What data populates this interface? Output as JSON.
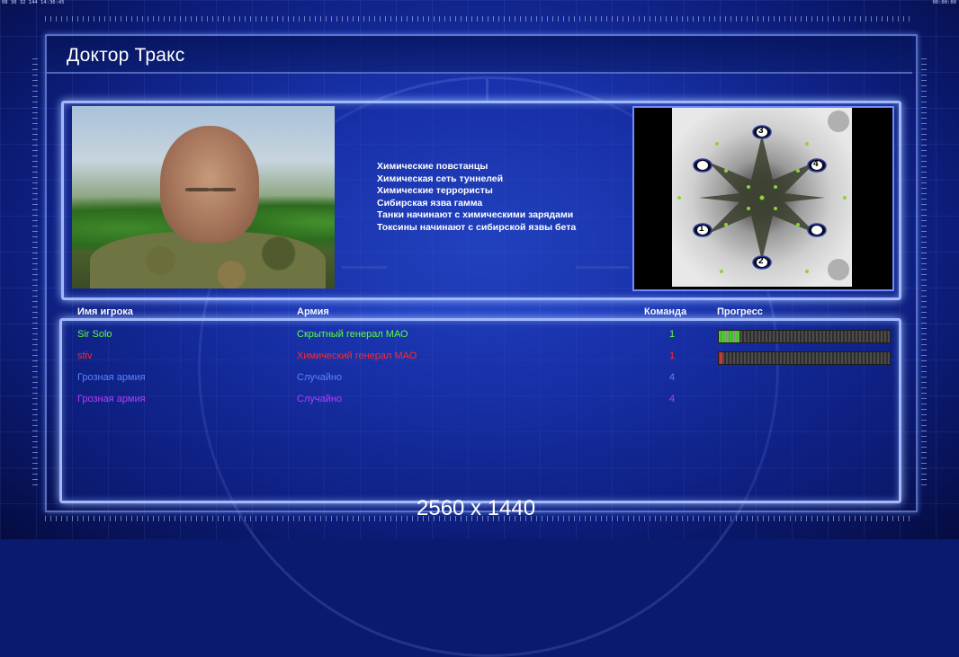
{
  "topbar": {
    "left": "08 30 32 144 14:36:45",
    "right": "00:00:00"
  },
  "header": {
    "title": "Доктор Тракс"
  },
  "briefing": {
    "units": [
      "Химические повстанцы",
      "Химическая сеть туннелей",
      "Химические террористы",
      "Сибирская язва гамма",
      "Танки начинают с химическими зарядами",
      "Токсины начинают с сибирской язвы бета"
    ],
    "map": {
      "spawn_labels": [
        "3",
        "4",
        "1",
        "2"
      ]
    }
  },
  "table": {
    "headers": {
      "name": "Имя игрока",
      "army": "Армия",
      "team": "Команда",
      "progress": "Прогресс"
    },
    "rows": [
      {
        "name": "Sir Solo",
        "army": "Скрытный генерал МАО",
        "team": "1",
        "color": "#5cff3a",
        "progress": 0.12,
        "bar_color": "#49d02a"
      },
      {
        "name": "stiv",
        "army": "Химический генерал МАО",
        "team": "1",
        "color": "#ff2a2a",
        "progress": 0.02,
        "bar_color": "#e01818"
      },
      {
        "name": "Грозная армия",
        "army": "Случайно",
        "team": "4",
        "color": "#5a84ff",
        "progress": null
      },
      {
        "name": "Грозная армия",
        "army": "Случайно",
        "team": "4",
        "color": "#b63cff",
        "progress": null
      }
    ]
  },
  "footer": {
    "resolution": "2560 x 1440"
  }
}
